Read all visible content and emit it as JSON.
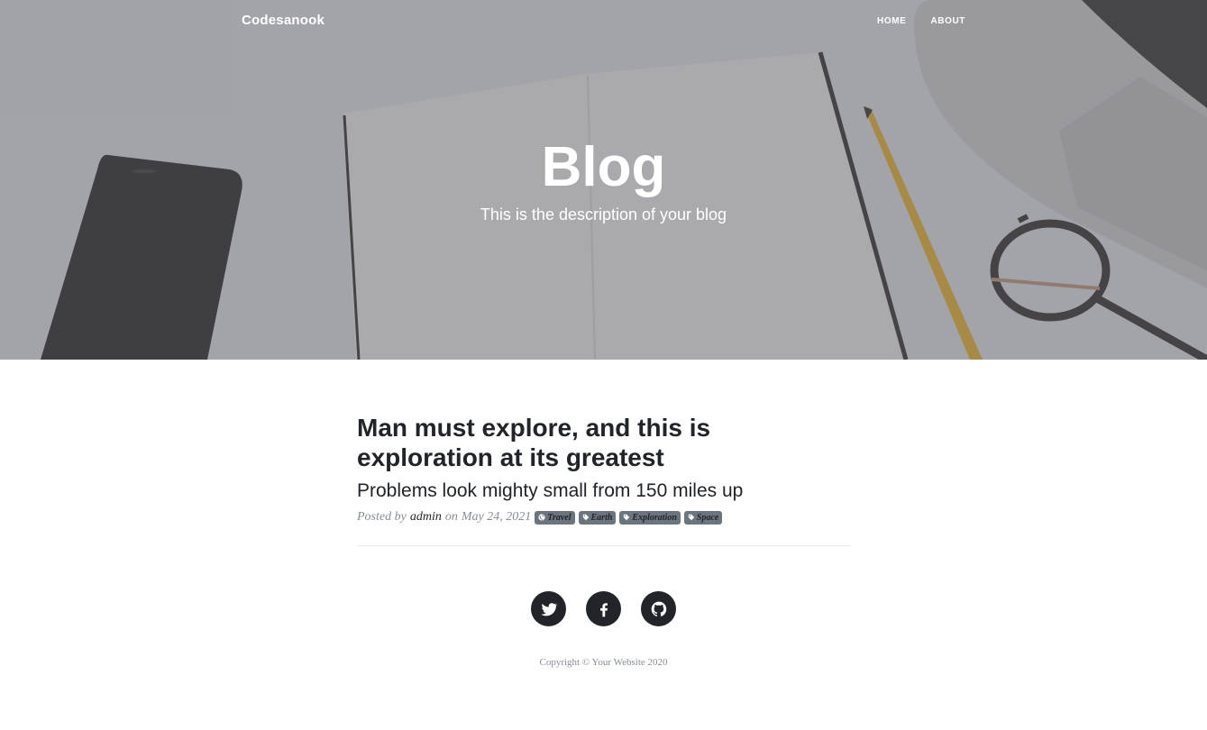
{
  "nav": {
    "brand": "Codesanook",
    "links": [
      {
        "label": "HOME"
      },
      {
        "label": "ABOUT"
      }
    ]
  },
  "hero": {
    "title": "Blog",
    "subtitle": "This is the description of your blog"
  },
  "post": {
    "title": "Man must explore, and this is exploration at its greatest",
    "subtitle": "Problems look mighty small from 150 miles up",
    "meta": {
      "posted_by": "Posted by",
      "author": "admin",
      "on": "on",
      "date": "May 24, 2021"
    },
    "tags": [
      {
        "label": "Travel",
        "icon": "globe-icon"
      },
      {
        "label": "Earth",
        "icon": "tag-icon"
      },
      {
        "label": "Exploration",
        "icon": "tag-icon"
      },
      {
        "label": "Space",
        "icon": "tag-icon"
      }
    ]
  },
  "footer": {
    "social": [
      {
        "name": "twitter-icon"
      },
      {
        "name": "facebook-icon"
      },
      {
        "name": "github-icon"
      }
    ],
    "copyright": "Copyright © Your Website 2020"
  },
  "colors": {
    "text": "#212529",
    "muted": "#868e96",
    "tag_bg": "#6c757d"
  }
}
